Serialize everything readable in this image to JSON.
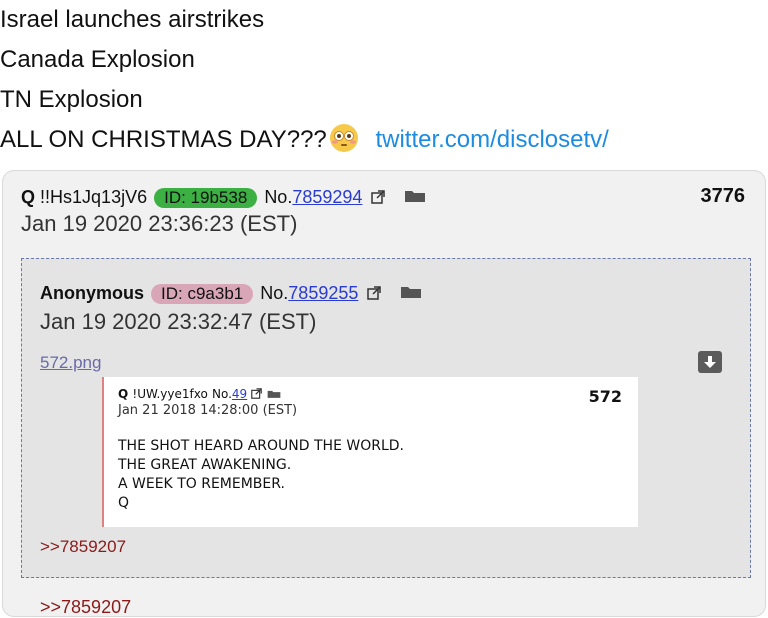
{
  "tweet": {
    "lines": [
      "Israel launches airstrikes",
      "Canada Explosion",
      "TN Explosion",
      "ALL ON CHRISTMAS DAY???"
    ],
    "emoji": "flushed-face-emoji",
    "link": "twitter.com/disclosetv/"
  },
  "post": {
    "name": "Q",
    "trip": "!!Hs1Jq13jV6",
    "id_label": "ID: 19b538",
    "no_prefix": "No.",
    "no_value": "7859294",
    "date": "Jan 19 2020 23:36:23 (EST)",
    "count": "3776",
    "id_color": "#3cb043"
  },
  "reply": {
    "name": "Anonymous",
    "id_label": "ID: c9a3b1",
    "no_prefix": "No.",
    "no_value": "7859255",
    "date": "Jan 19 2020 23:32:47 (EST)",
    "file_name": "572.png",
    "greentext": ">>7859207",
    "id_color": "#d9a6b8"
  },
  "embed": {
    "name": "Q",
    "trip": "!UW.yye1fxo",
    "no_prefix": "No.",
    "no_value": "49",
    "date": "Jan 21 2018 14:28:00 (EST)",
    "count": "572",
    "body": "THE SHOT HEARD AROUND THE WORLD.\nTHE GREAT AWAKENING.\nA WEEK TO REMEMBER.\nQ"
  },
  "cutoff_text": ">>7859207"
}
